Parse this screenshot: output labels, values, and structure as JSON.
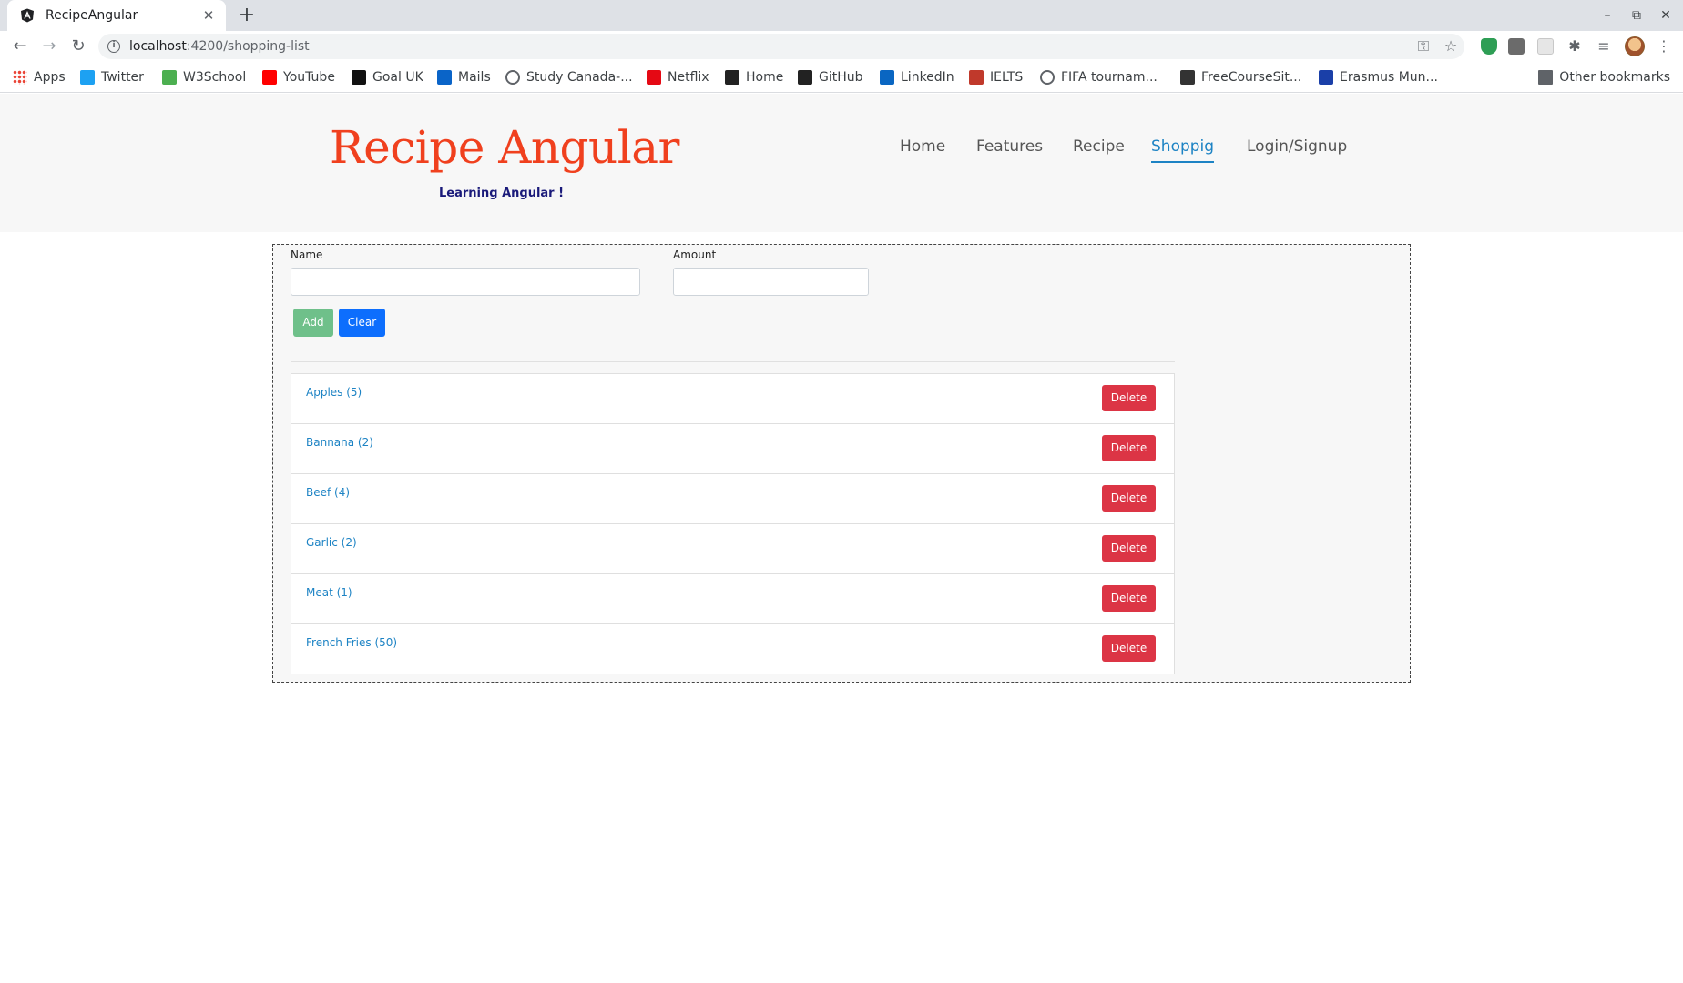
{
  "browser": {
    "tab_title": "RecipeAngular",
    "tab_close": "✕",
    "new_tab": "+",
    "url_host": "localhost",
    "url_path": ":4200/shopping-list",
    "window_controls": [
      "–",
      "⧉",
      "✕"
    ],
    "bookmarks": [
      {
        "label": "Apps",
        "icon": "apps-grid-icon"
      },
      {
        "label": "Twitter",
        "icon": "twitter-icon",
        "color": "#1da1f2"
      },
      {
        "label": "W3School",
        "icon": "w3school-icon",
        "color": "#4caf50"
      },
      {
        "label": "YouTube",
        "icon": "youtube-icon",
        "color": "#ff0000"
      },
      {
        "label": "Goal UK",
        "icon": "goal-icon",
        "color": "#111111"
      },
      {
        "label": "Mails",
        "icon": "outlook-icon",
        "color": "#0a64c8"
      },
      {
        "label": "Study Canada-...",
        "icon": "globe-icon",
        "color": "#5f6368"
      },
      {
        "label": "Netflix",
        "icon": "netflix-icon",
        "color": "#e50914"
      },
      {
        "label": "Home",
        "icon": "home-c-icon",
        "color": "#222222"
      },
      {
        "label": "GitHub",
        "icon": "github-icon",
        "color": "#222222"
      },
      {
        "label": "LinkedIn",
        "icon": "linkedin-icon",
        "color": "#0a66c2"
      },
      {
        "label": "IELTS",
        "icon": "ielts-icon",
        "color": "#c0392b"
      },
      {
        "label": "FIFA tournam...",
        "icon": "globe-icon",
        "color": "#5f6368"
      },
      {
        "label": "FreeCourseSit...",
        "icon": "freecourse-icon",
        "color": "#333333"
      },
      {
        "label": "Erasmus Mun...",
        "icon": "erasmus-icon",
        "color": "#1a3fa8"
      }
    ],
    "other_bookmarks": "Other bookmarks"
  },
  "header": {
    "brand": "Recipe Angular",
    "tagline": "Learning Angular !",
    "nav": [
      {
        "label": "Home",
        "active": false
      },
      {
        "label": "Features",
        "active": false
      },
      {
        "label": "Recipe",
        "active": false
      },
      {
        "label": "Shoppig",
        "active": true
      },
      {
        "label": "Login/Signup",
        "active": false
      }
    ]
  },
  "form": {
    "name_label": "Name",
    "name_value": "",
    "amount_label": "Amount",
    "amount_value": "",
    "add_label": "Add",
    "clear_label": "Clear"
  },
  "shopping_list": [
    {
      "text": "Apples (5)",
      "delete_label": "Delete"
    },
    {
      "text": "Bannana (2)",
      "delete_label": "Delete"
    },
    {
      "text": "Beef (4)",
      "delete_label": "Delete"
    },
    {
      "text": "Garlic (2)",
      "delete_label": "Delete"
    },
    {
      "text": "Meat (1)",
      "delete_label": "Delete"
    },
    {
      "text": "French Fries (50)",
      "delete_label": "Delete"
    }
  ],
  "colors": {
    "brand": "#f0401e",
    "nav_active": "#1d83c4",
    "add_button": "#6fc08a",
    "clear_button": "#0d6efd",
    "delete_button": "#dc3545"
  }
}
